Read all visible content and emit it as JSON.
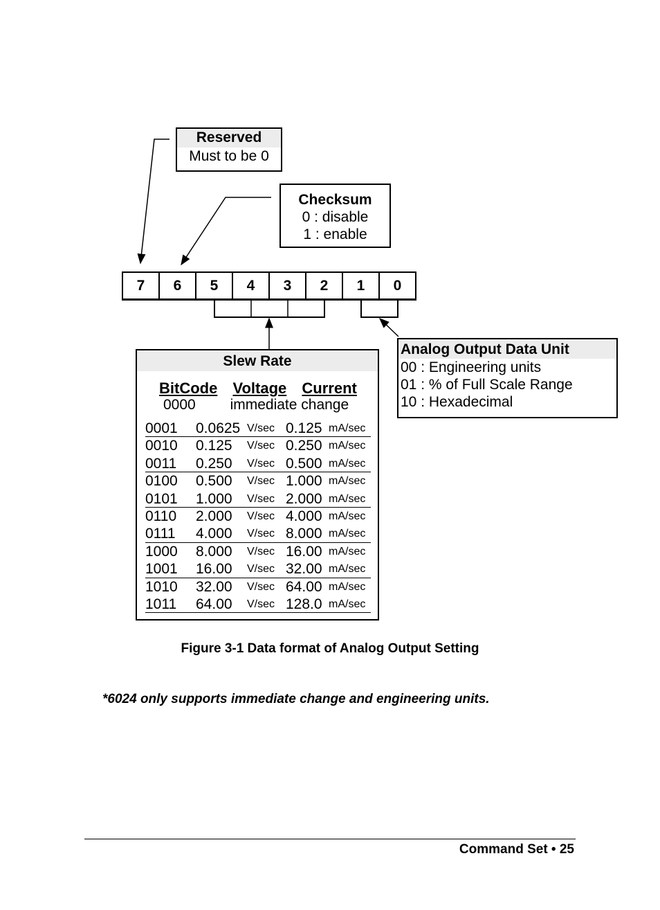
{
  "reserved": {
    "title": "Reserved",
    "desc": "Must to be 0"
  },
  "checksum": {
    "title": "Checksum",
    "lines": [
      "0 : disable",
      "1 : enable"
    ]
  },
  "bits": [
    "7",
    "6",
    "5",
    "4",
    "3",
    "2",
    "1",
    "0"
  ],
  "slew_rate": {
    "title": "Slew Rate",
    "columns": [
      "BitCode",
      "Voltage",
      "Current"
    ],
    "immediate": {
      "code": "0000",
      "text": "immediate change"
    },
    "rows": [
      {
        "code": "0001",
        "voltage": "0.0625",
        "v_unit": "V/sec",
        "current": "0.125",
        "c_unit": "mA/sec"
      },
      {
        "code": "0010",
        "voltage": "0.125",
        "v_unit": "V/sec",
        "current": "0.250",
        "c_unit": "mA/sec"
      },
      {
        "code": "0011",
        "voltage": "0.250",
        "v_unit": "V/sec",
        "current": "0.500",
        "c_unit": "mA/sec"
      },
      {
        "code": "0100",
        "voltage": "0.500",
        "v_unit": "V/sec",
        "current": "1.000",
        "c_unit": "mA/sec"
      },
      {
        "code": "0101",
        "voltage": "1.000",
        "v_unit": "V/sec",
        "current": "2.000",
        "c_unit": "mA/sec"
      },
      {
        "code": "0110",
        "voltage": "2.000",
        "v_unit": "V/sec",
        "current": "4.000",
        "c_unit": "mA/sec"
      },
      {
        "code": "0111",
        "voltage": "4.000",
        "v_unit": "V/sec",
        "current": "8.000",
        "c_unit": "mA/sec"
      },
      {
        "code": "1000",
        "voltage": "8.000",
        "v_unit": "V/sec",
        "current": "16.00",
        "c_unit": "mA/sec"
      },
      {
        "code": "1001",
        "voltage": "16.00",
        "v_unit": "V/sec",
        "current": "32.00",
        "c_unit": "mA/sec"
      },
      {
        "code": "1010",
        "voltage": "32.00",
        "v_unit": "V/sec",
        "current": "64.00",
        "c_unit": "mA/sec"
      },
      {
        "code": "1011",
        "voltage": "64.00",
        "v_unit": "V/sec",
        "current": "128.0",
        "c_unit": "mA/sec"
      }
    ]
  },
  "data_unit": {
    "title": "Analog Output Data Unit",
    "lines": [
      "00 : Engineering units",
      "01 : % of Full Scale Range",
      "10 : Hexadecimal"
    ]
  },
  "caption": "Figure 3-1 Data format of Analog Output Setting",
  "note": "*6024 only supports immediate change and engineering units.",
  "footer": "Command Set • 25"
}
